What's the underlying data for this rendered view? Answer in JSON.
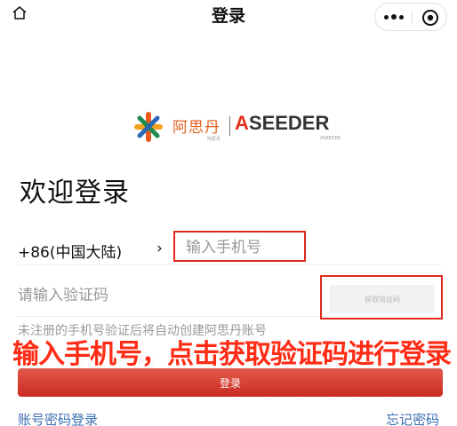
{
  "navbar": {
    "title": "登录",
    "home_icon": "home-icon",
    "more_icon": "more-dots-icon",
    "close_icon": "target-circle-icon"
  },
  "logo": {
    "brand_cn": "阿思丹",
    "brand_en_prefix": "A",
    "brand_en_rest": "SEEDER",
    "sub_cn": "阿思丹",
    "sub_en": "ASEEDER",
    "mark_icon": "asterisk-logo-icon"
  },
  "welcome": "欢迎登录",
  "phone": {
    "country_code": "+86(中国大陆)",
    "chevron": "›",
    "placeholder": "输入手机号",
    "value": ""
  },
  "code": {
    "placeholder": "请输入验证码",
    "value": "",
    "get_code_label": "获取验证码"
  },
  "notice": "未注册的手机号验证后将自动创建阿思丹账号",
  "overlay_text": "输入手机号，点击获取验证码进行登录",
  "login_button": "登录",
  "links": {
    "password_login": "账号密码登录",
    "forgot_password": "忘记密码"
  },
  "colors": {
    "highlight": "#e02a1c",
    "button": "#d03a2e",
    "link": "#3b6fb0",
    "brand_orange": "#e0611f"
  }
}
